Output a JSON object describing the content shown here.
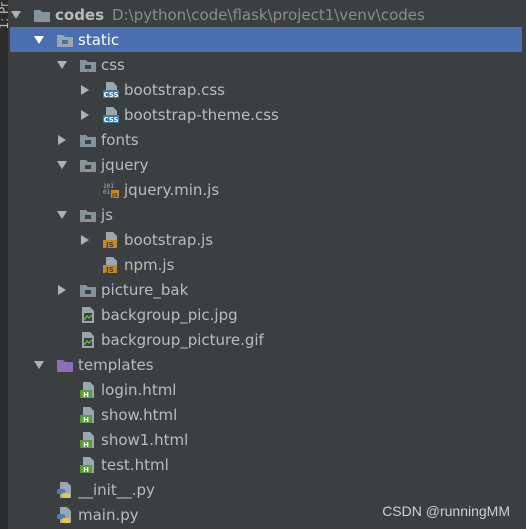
{
  "side_tab": {
    "label": "1: Pr"
  },
  "tree": {
    "root": {
      "name": "codes",
      "path": "D:\\python\\code\\flask\\project1\\venv\\codes"
    },
    "static": "static",
    "css": "css",
    "bootstrap_css": "bootstrap.css",
    "bootstrap_theme_css": "bootstrap-theme.css",
    "fonts": "fonts",
    "jquery": "jquery",
    "jquery_min_js": "jquery.min.js",
    "js": "js",
    "bootstrap_js": "bootstrap.js",
    "npm_js": "npm.js",
    "picture_bak": "picture_bak",
    "backgroup_pic": "backgroup_pic.jpg",
    "backgroup_picture": "backgroup_picture.gif",
    "templates": "templates",
    "login_html": "login.html",
    "show_html": "show.html",
    "show1_html": "show1.html",
    "test_html": "test.html",
    "init_py": "__init__.py",
    "main_py": "main.py"
  },
  "icons": {
    "folder": "folder-icon",
    "templates_folder": "templates-folder-icon",
    "css_file": "css-file-icon",
    "js_file": "js-file-icon",
    "minified_js_file": "minified-js-file-icon",
    "image_file": "image-file-icon",
    "html_file": "html-file-icon",
    "python_file": "python-file-icon"
  },
  "colors": {
    "background": "#3c3f41",
    "selection": "#4b6eaf",
    "text": "#bbbbbb",
    "path_text": "#8c8c8c",
    "folder": "#87939a",
    "templates_folder": "#8a6fb8",
    "css_badge": "#3a7aa8",
    "js_badge": "#c28a2c",
    "html_badge": "#5c9a3c"
  },
  "watermark": "CSDN @runningMM"
}
